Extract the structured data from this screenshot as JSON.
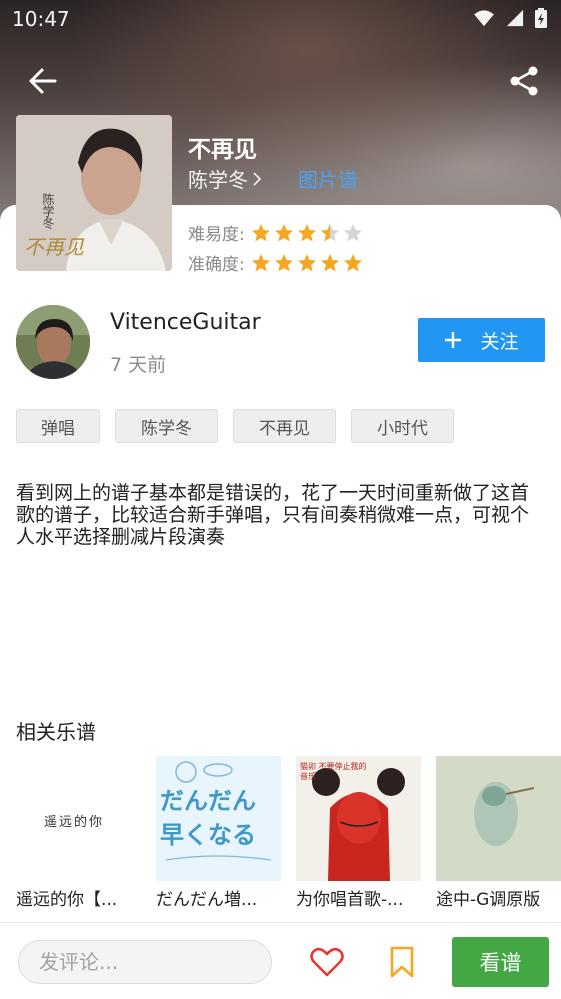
{
  "status_bar": {
    "time": "10:47"
  },
  "song": {
    "title": "不再见",
    "artist": "陈学冬",
    "tab_type": "图片谱",
    "cover_text": {
      "artist": "陈学冬",
      "title": "不再见"
    }
  },
  "ratings": {
    "difficulty_label": "难易度:",
    "difficulty_stars": 3.5,
    "accuracy_label": "准确度:",
    "accuracy_stars": 5,
    "star_color": "#f5a623",
    "empty_star_color": "#d6d6d6"
  },
  "author": {
    "name": "VitenceGuitar",
    "time": "7 天前",
    "follow_label": "关注"
  },
  "tags": [
    "弹唱",
    "陈学冬",
    "不再见",
    "小时代"
  ],
  "description": "看到网上的谱子基本都是错误的，花了一天时间重新做了这首歌的谱子，比较适合新手弹唱，只有间奏稍微难一点，可视个人水平选择删减片段演奏",
  "related": {
    "title": "相关乐谱",
    "items": [
      {
        "label": "遥远的你【...",
        "thumb_text": "遥远的你"
      },
      {
        "label": "だんだん増...",
        "thumb_text": "だんだん 早くなる"
      },
      {
        "label": "为你唱首歌-...",
        "thumb_text": "猫卯 不要停止我的音乐"
      },
      {
        "label": "途中-G调原版",
        "thumb_text": ""
      }
    ]
  },
  "bottom_bar": {
    "comment_placeholder": "发评论...",
    "view_label": "看谱"
  },
  "colors": {
    "accent_blue": "#2196f3",
    "link_blue": "#4aa3ef",
    "green": "#43a843",
    "red_heart": "#e53935",
    "bookmark_orange": "#f5a623"
  }
}
